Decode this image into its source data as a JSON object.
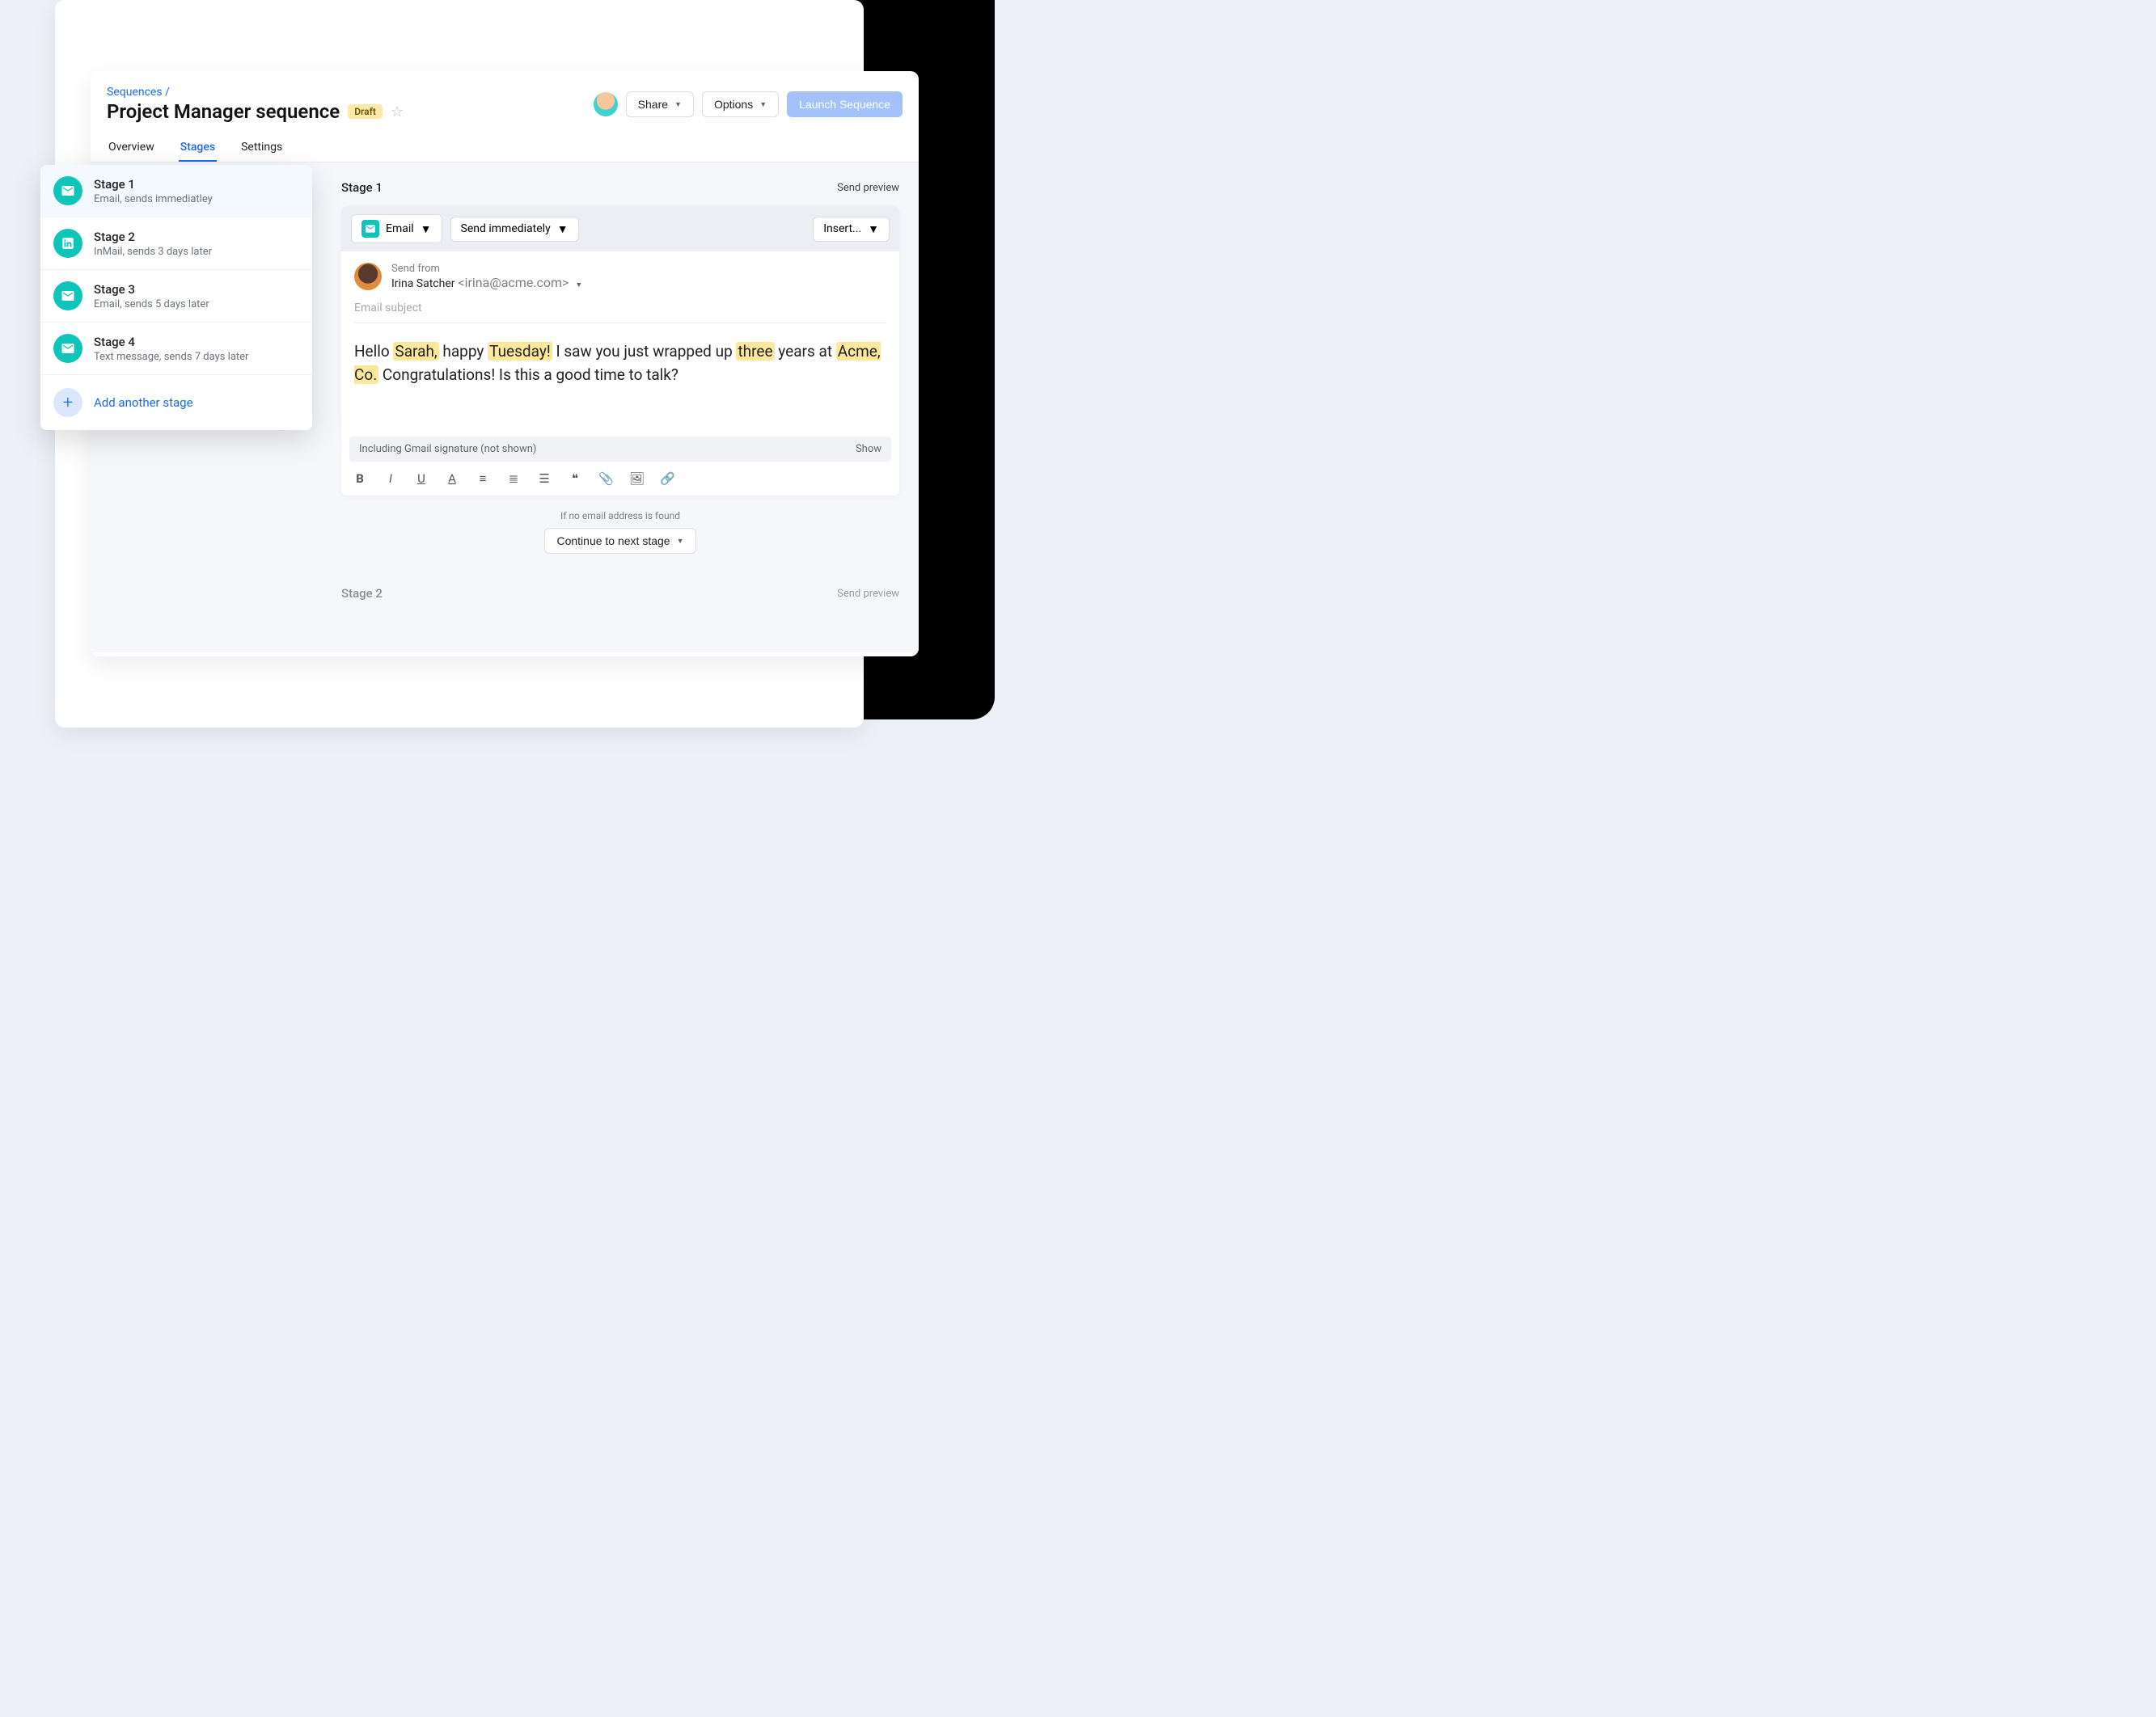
{
  "breadcrumb": {
    "root": "Sequences",
    "sep": "/"
  },
  "page": {
    "title": "Project Manager sequence",
    "status": "Draft"
  },
  "actions": {
    "share": "Share",
    "options": "Options",
    "launch": "Launch Sequence"
  },
  "tabs": {
    "overview": "Overview",
    "stages": "Stages",
    "settings": "Settings"
  },
  "sidebar": {
    "stages": [
      {
        "title": "Stage 1",
        "subtitle": "Email, sends immediatley",
        "icon": "mail"
      },
      {
        "title": "Stage 2",
        "subtitle": "InMail, sends 3 days later",
        "icon": "linkedin"
      },
      {
        "title": "Stage 3",
        "subtitle": "Email, sends 5 days later",
        "icon": "mail"
      },
      {
        "title": "Stage 4",
        "subtitle": "Text message, sends 7 days later",
        "icon": "mail"
      }
    ],
    "add_label": "Add another stage"
  },
  "stage1": {
    "header": "Stage 1",
    "send_preview": "Send preview",
    "type_label": "Email",
    "timing_label": "Send immediately",
    "insert_label": "Insert...",
    "send_from_label": "Send from",
    "sender_name": "Irina Satcher",
    "sender_email": "<irina@acme.com>",
    "subject_placeholder": "Email subject",
    "body_parts": {
      "p1": "Hello ",
      "h1": "Sarah,",
      "p2": " happy ",
      "h2": "Tuesday!",
      "p3": " I saw you just wrapped up ",
      "h3": "three",
      "p4": " years at ",
      "h4": "Acme, Co.",
      "p5": " Congratulations! Is this a good time to talk?"
    },
    "signature_note": "Including Gmail signature (not shown)",
    "signature_show": "Show",
    "fallback_label": "If no email address is found",
    "fallback_action": "Continue to next stage"
  },
  "stage2": {
    "header": "Stage 2",
    "send_preview": "Send preview"
  }
}
